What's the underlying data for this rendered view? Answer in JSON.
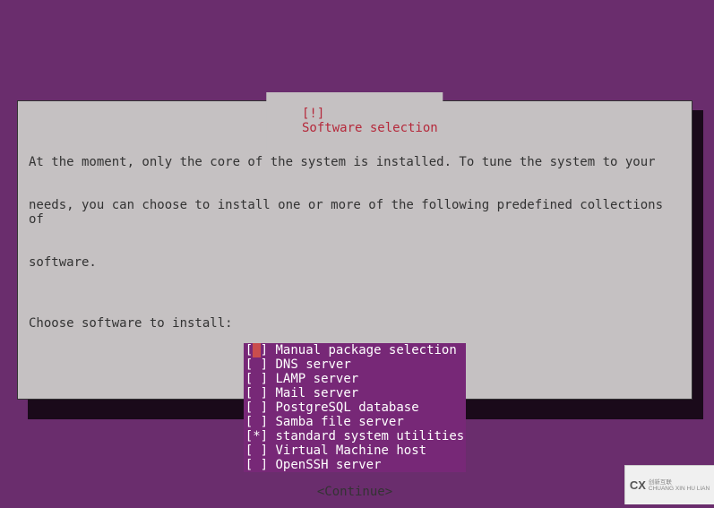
{
  "dialog": {
    "title_left": "[!]",
    "title_text": "Software selection",
    "intro_line1": "At the moment, only the core of the system is installed. To tune the system to your",
    "intro_line2": "needs, you can choose to install one or more of the following predefined collections of",
    "intro_line3": "software.",
    "choose_label": "Choose software to install:",
    "items": [
      {
        "checked": false,
        "highlighted": true,
        "label": "Manual package selection"
      },
      {
        "checked": false,
        "highlighted": false,
        "label": "DNS server"
      },
      {
        "checked": false,
        "highlighted": false,
        "label": "LAMP server"
      },
      {
        "checked": false,
        "highlighted": false,
        "label": "Mail server"
      },
      {
        "checked": false,
        "highlighted": false,
        "label": "PostgreSQL database"
      },
      {
        "checked": false,
        "highlighted": false,
        "label": "Samba file server"
      },
      {
        "checked": true,
        "highlighted": false,
        "label": "standard system utilities"
      },
      {
        "checked": false,
        "highlighted": false,
        "label": "Virtual Machine host"
      },
      {
        "checked": false,
        "highlighted": false,
        "label": "OpenSSH server"
      }
    ],
    "continue_label": "<Continue>"
  },
  "watermark": {
    "logo": "CX",
    "line1": "创新互联",
    "line2": "CHUANG XIN HU LIAN"
  }
}
